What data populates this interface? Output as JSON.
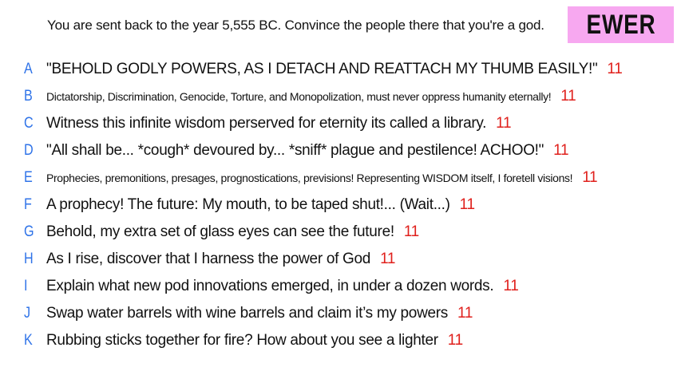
{
  "prompt": "You are sent back to the year 5,555 BC. Convince the people there that you're a god.",
  "badge": "EWER",
  "colors": {
    "letter": "#2f73e8",
    "score": "#e0201c",
    "badge_bg": "#f7a8f0"
  },
  "answers": [
    {
      "letter": "A",
      "text": "\"BEHOLD GODLY POWERS, AS I DETACH AND REATTACH MY THUMB EASILY!\"",
      "score": "11",
      "small": false
    },
    {
      "letter": "B",
      "text": "Dictatorship, Discrimination, Genocide, Torture, and Monopolization, must never oppress humanity eternally!",
      "score": "11",
      "small": true
    },
    {
      "letter": "C",
      "text": "Witness this infinite wisdom perserved for eternity its called a library.",
      "score": "11",
      "small": false
    },
    {
      "letter": "D",
      "text": "\"All shall be... *cough* devoured by... *sniff* plague and pestilence! ACHOO!\"",
      "score": "11",
      "small": false
    },
    {
      "letter": "E",
      "text": "Prophecies, premonitions, presages, prognostications, previsions! Representing WISDOM itself, I foretell visions!",
      "score": "11",
      "small": true
    },
    {
      "letter": "F",
      "text": "A prophecy!  The future: My mouth, to be taped shut!... (Wait...)",
      "score": "11",
      "small": false
    },
    {
      "letter": "G",
      "text": "Behold, my extra set of glass eyes can see the future!",
      "score": "11",
      "small": false
    },
    {
      "letter": "H",
      "text": "As I rise, discover that I harness the power of God",
      "score": "11",
      "small": false
    },
    {
      "letter": "I",
      "text": "Explain what new pod innovations emerged, in under a dozen words.",
      "score": "11",
      "small": false
    },
    {
      "letter": "J",
      "text": "Swap water barrels with wine barrels and claim it’s my powers",
      "score": "11",
      "small": false
    },
    {
      "letter": "K",
      "text": "Rubbing sticks together for fire? How about you see a lighter",
      "score": "11",
      "small": false
    }
  ]
}
